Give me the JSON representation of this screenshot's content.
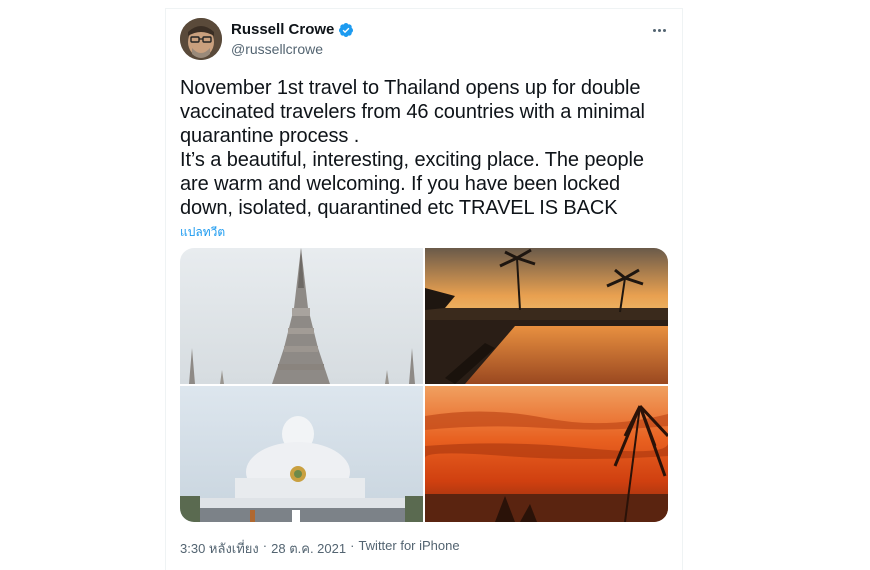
{
  "author": {
    "name": "Russell Crowe",
    "handle": "@russellcrowe",
    "verified": true
  },
  "icons": {
    "verified": "verified-badge-icon",
    "more": "more-options-icon"
  },
  "tweet": {
    "lines": [
      "November 1st travel to Thailand opens up for double vaccinated travelers from 46 countries with a minimal quarantine process .",
      "It’s a beautiful, interesting, exciting place. The people are warm and welcoming. If you have been locked down, isolated, quarantined etc TRAVEL IS BACK"
    ],
    "translate_label": "แปลทวีต"
  },
  "media": {
    "photos": [
      "temple-spire-photo",
      "pool-sunset-photo",
      "white-buddha-photo",
      "ocean-sunset-photo"
    ]
  },
  "meta": {
    "time": "3:30 หลังเที่ยง",
    "separator1": "·",
    "date": "28 ต.ค. 2021",
    "separator2": "·",
    "source": "Twitter for iPhone"
  },
  "colors": {
    "text": "#0f1419",
    "secondary": "#536471",
    "accent": "#1d9bf0"
  }
}
